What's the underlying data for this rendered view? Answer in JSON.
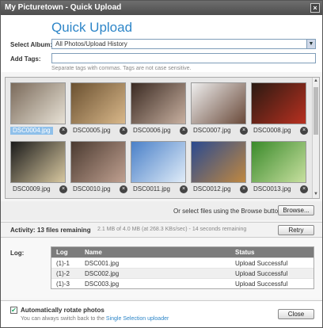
{
  "window": {
    "title": "My Picturetown - Quick Upload",
    "close_glyph": "×"
  },
  "header": {
    "heading": "Quick Upload",
    "album_label": "Select Album:",
    "album_value": "All Photos/Upload History",
    "tags_label": "Add Tags:",
    "tags_value": "",
    "tags_hint": "Separate tags with commas. Tags are not case sensitive."
  },
  "gallery": {
    "items": [
      {
        "name": "DSC0004.jpg",
        "selected": true,
        "colors": [
          "#7a6a5a",
          "#e8e2d6"
        ]
      },
      {
        "name": "DSC0005.jpg",
        "selected": false,
        "colors": [
          "#6a5030",
          "#d9b88a"
        ]
      },
      {
        "name": "DSC0006.jpg",
        "selected": false,
        "colors": [
          "#3a2a22",
          "#c8b0a0"
        ]
      },
      {
        "name": "DSC0007.jpg",
        "selected": false,
        "colors": [
          "#eeeeee",
          "#6a4a3a"
        ]
      },
      {
        "name": "DSC0008.jpg",
        "selected": false,
        "colors": [
          "#2a1a12",
          "#b83020"
        ]
      },
      {
        "name": "DSC0009.jpg",
        "selected": false,
        "colors": [
          "#1a1a1a",
          "#d8c8a0"
        ]
      },
      {
        "name": "DSC0010.jpg",
        "selected": false,
        "colors": [
          "#4a3a30",
          "#c0a090"
        ]
      },
      {
        "name": "DSC0011.jpg",
        "selected": false,
        "colors": [
          "#4a80c8",
          "#e0ecf8"
        ]
      },
      {
        "name": "DSC0012.jpg",
        "selected": false,
        "colors": [
          "#2a4a90",
          "#c08840"
        ]
      },
      {
        "name": "DSC0013.jpg",
        "selected": false,
        "colors": [
          "#3a8a2a",
          "#c8e0a0"
        ]
      }
    ],
    "remove_glyph": "×"
  },
  "browse": {
    "text": "Or select files using the Browse button",
    "button": "Browse..."
  },
  "activity": {
    "label": "Activity:",
    "count": "13 files remaining",
    "detail": "2.1 MB of 4.0 MB (at 268.3 KBs/sec) - 14 seconds remaining",
    "retry": "Retry"
  },
  "log": {
    "label": "Log:",
    "columns": [
      "Log",
      "Name",
      "Status"
    ],
    "rows": [
      [
        "(1)-1",
        "DSC001.jpg",
        "Upload Successful"
      ],
      [
        "(1)-2",
        "DSC002.jpg",
        "Upload Successful"
      ],
      [
        "(1)-3",
        "DSC003.jpg",
        "Upload Successful"
      ]
    ]
  },
  "footer": {
    "auto_rotate_checked": true,
    "check_glyph": "✔",
    "auto_rotate_label": "Automatically rotate photos",
    "switch_text": "You can always switch back to the",
    "switch_link": "Single Selection uploader",
    "close": "Close"
  }
}
